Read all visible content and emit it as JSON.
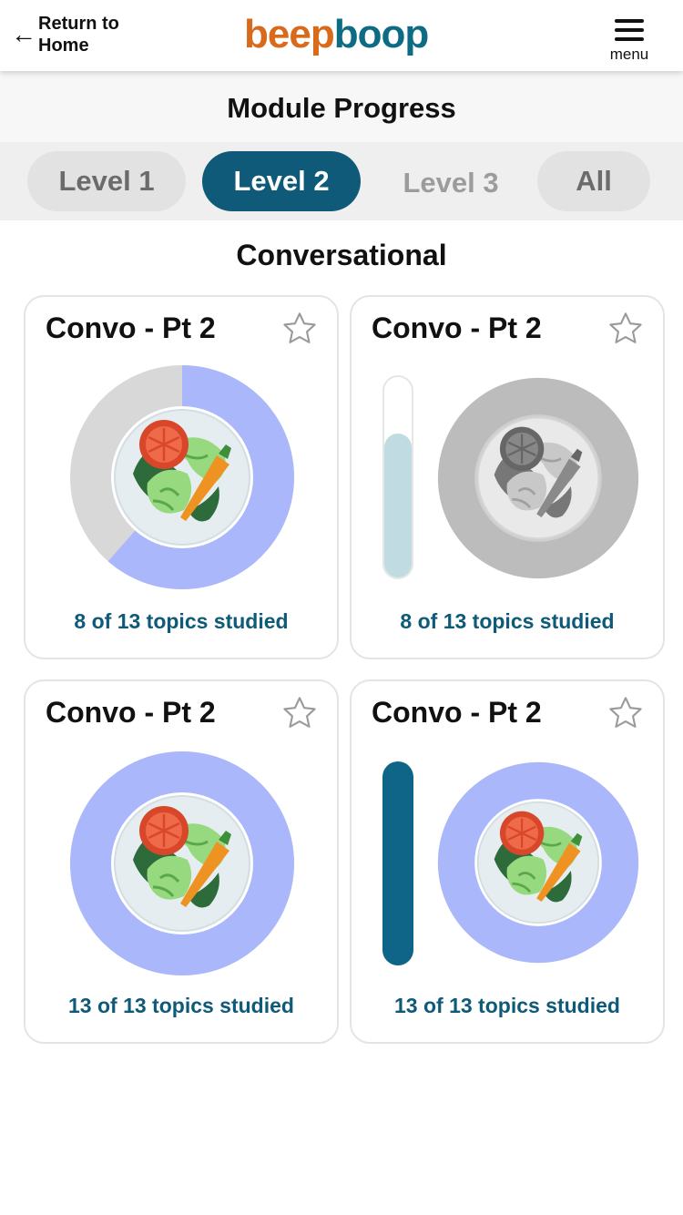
{
  "header": {
    "back_label": "Return to Home",
    "logo_part1": "beep",
    "logo_part2": "boop",
    "menu_label": "menu",
    "brand_orange": "#d96a1c",
    "brand_teal": "#0e6b84"
  },
  "page_title": "Module Progress",
  "tabs": [
    {
      "label": "Level 1",
      "selected": false
    },
    {
      "label": "Level 2",
      "selected": true
    },
    {
      "label": "Level 3",
      "selected": false
    },
    {
      "label": "All",
      "selected": false
    }
  ],
  "section_title": "Conversational",
  "cards": [
    {
      "title": "Convo - Pt 2",
      "footer": "8 of 13 topics studied",
      "progress": 0.615,
      "style": "ring",
      "starred": false
    },
    {
      "title": "Convo - Pt 2",
      "footer": "8 of 13 topics studied",
      "progress": 0.72,
      "style": "bar-greyed",
      "starred": false
    },
    {
      "title": "Convo - Pt 2",
      "footer": "13 of 13 topics studied",
      "progress": 1.0,
      "style": "ring",
      "starred": false
    },
    {
      "title": "Convo - Pt 2",
      "footer": "13 of 13 topics studied",
      "progress": 1.0,
      "style": "bar",
      "starred": false
    }
  ],
  "colors": {
    "ring_fill": "#aab8fb",
    "ring_empty": "#d8d8d8",
    "plate_disabled": "#bcbcbc",
    "bar_light": "#c0dbe2",
    "bar_dark": "#0e6587",
    "bar_track": "#ffffff"
  }
}
